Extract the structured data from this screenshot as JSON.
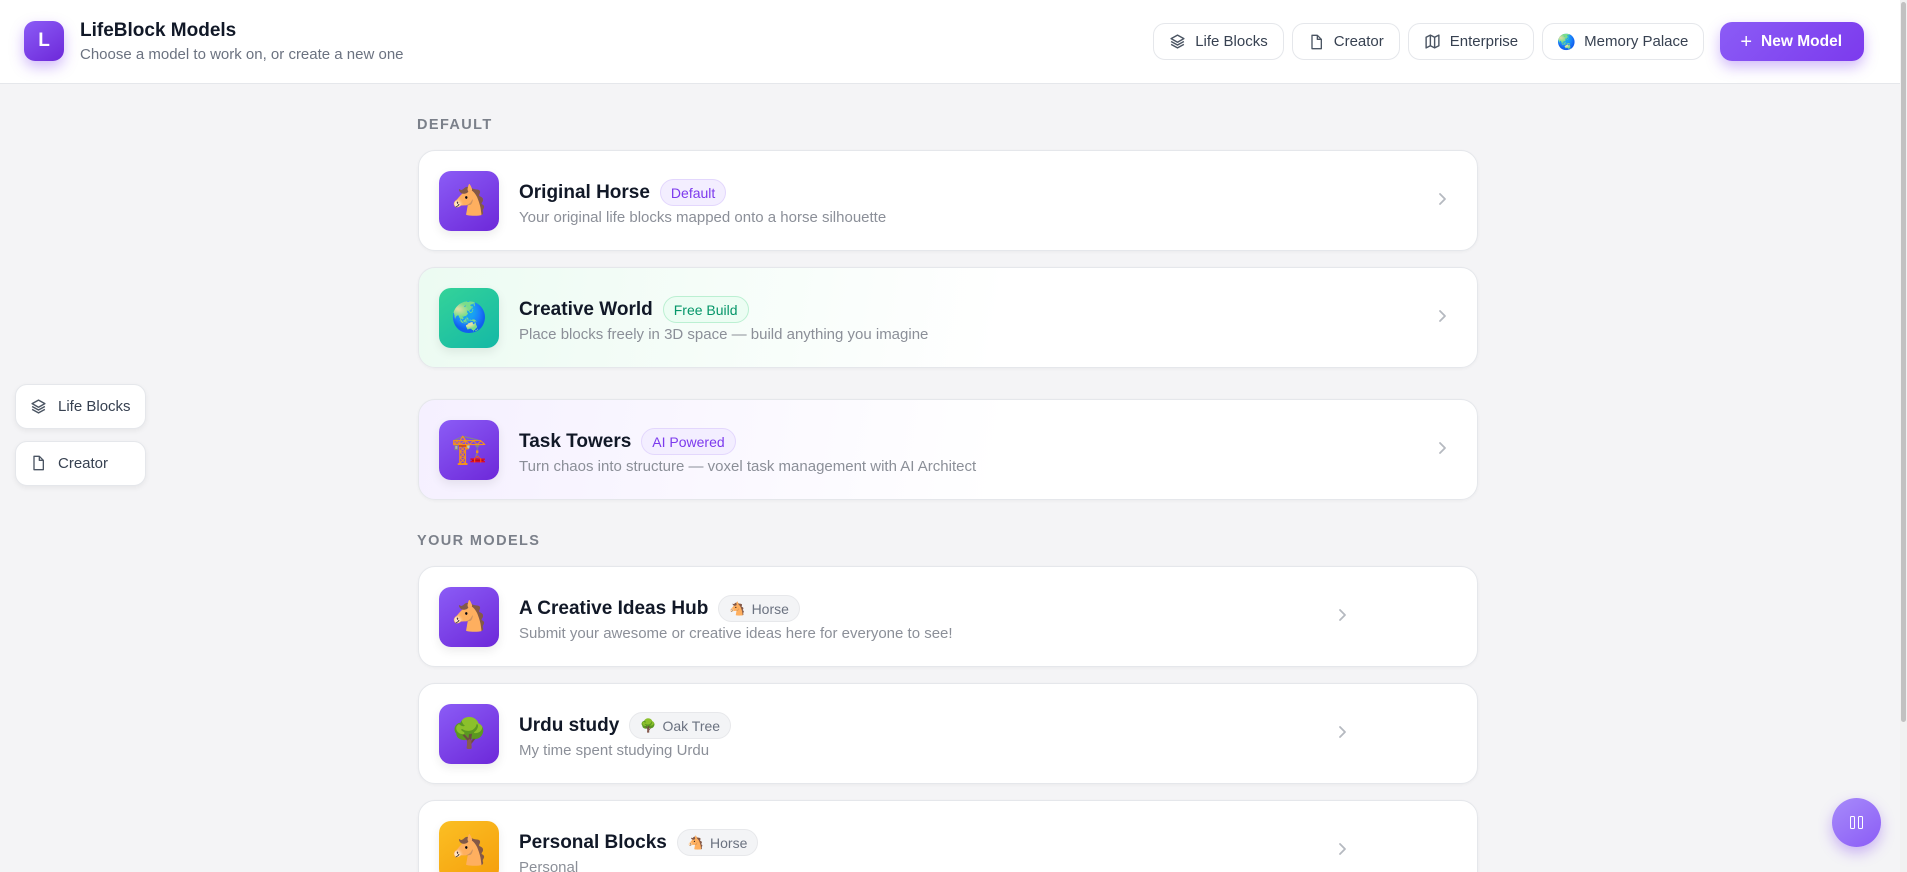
{
  "header": {
    "logo_letter": "L",
    "title": "LifeBlock Models",
    "subtitle": "Choose a model to work on, or create a new one",
    "nav": [
      {
        "label": "Life Blocks",
        "icon": "layers-icon"
      },
      {
        "label": "Creator",
        "icon": "file-icon"
      },
      {
        "label": "Enterprise",
        "icon": "map-icon"
      },
      {
        "label": "Memory Palace",
        "icon": "globe-icon",
        "glyph": "🌏"
      }
    ],
    "new_model_label": "New Model",
    "new_model_icon": "+"
  },
  "side_nav": [
    {
      "label": "Life Blocks",
      "icon": "layers-icon"
    },
    {
      "label": "Creator",
      "icon": "file-icon"
    }
  ],
  "sections": {
    "default_label": "DEFAULT",
    "your_models_label": "YOUR MODELS"
  },
  "default_models": [
    {
      "title": "Original Horse",
      "badge": "Default",
      "desc": "Your original life blocks mapped onto a horse silhouette",
      "glyph": "🐴",
      "icon": "horse-icon",
      "tile_color": "#7c3aed"
    },
    {
      "title": "Creative World",
      "badge": "Free Build",
      "desc": "Place blocks freely in 3D space — build anything you imagine",
      "glyph": "🌏",
      "icon": "globe-icon",
      "tile_color": "#14b8a6"
    },
    {
      "title": "Task Towers",
      "badge": "AI Powered",
      "desc": "Turn chaos into structure — voxel task management with AI Architect",
      "glyph": "🏗️",
      "icon": "construction-crane-icon",
      "tile_color": "#7c3aed"
    }
  ],
  "your_models": [
    {
      "title": "A Creative Ideas Hub",
      "badge": "Horse",
      "badge_glyph": "🐴",
      "desc": "Submit your awesome or creative ideas here for everyone to see!",
      "glyph": "🐴",
      "icon": "horse-icon",
      "tile_color": "#7c3aed"
    },
    {
      "title": "Urdu study",
      "badge": "Oak Tree",
      "badge_glyph": "🌳",
      "desc": "My time spent studying Urdu",
      "glyph": "🌳",
      "icon": "tree-icon",
      "tile_color": "#7c3aed"
    },
    {
      "title": "Personal Blocks",
      "badge": "Horse",
      "badge_glyph": "🐴",
      "desc": "Personal",
      "glyph": "🐴",
      "icon": "horse-icon",
      "tile_color": "#f59e0b"
    }
  ],
  "colors": {
    "accent": "#7c3aed",
    "background": "#f4f4f6",
    "card_border": "#e5e7eb",
    "muted_text": "#8b8f98"
  }
}
